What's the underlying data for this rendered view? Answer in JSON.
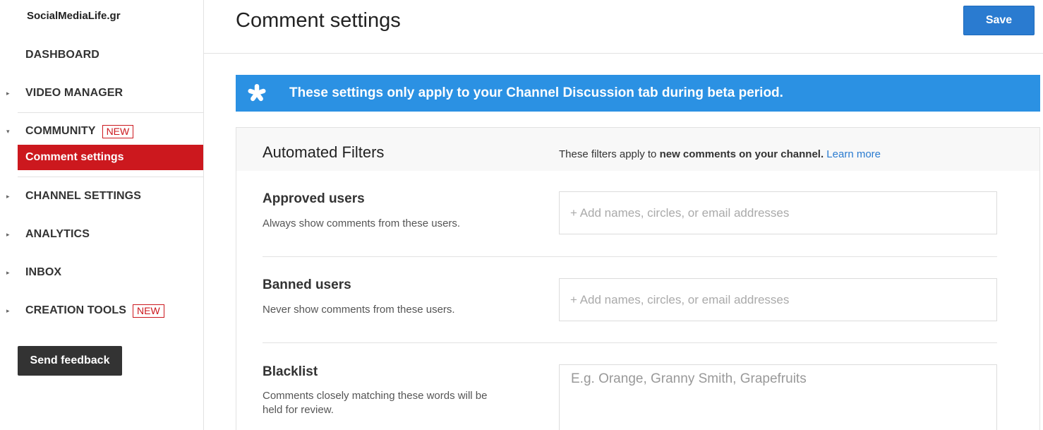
{
  "sidebar": {
    "channel_name": "SocialMediaLife.gr",
    "items": [
      {
        "label": "DASHBOARD",
        "arrow": ""
      },
      {
        "label": "VIDEO MANAGER",
        "arrow": "▸"
      },
      {
        "label": "COMMUNITY",
        "arrow": "▾",
        "badge": "NEW"
      },
      {
        "label": "CHANNEL SETTINGS",
        "arrow": "▸"
      },
      {
        "label": "ANALYTICS",
        "arrow": "▸"
      },
      {
        "label": "INBOX",
        "arrow": "▸"
      },
      {
        "label": "CREATION TOOLS",
        "arrow": "▸",
        "badge": "NEW"
      }
    ],
    "active_sub_item": "Comment settings",
    "feedback_label": "Send feedback"
  },
  "header": {
    "title": "Comment settings",
    "save_label": "Save"
  },
  "banner": {
    "icon": "asterisk-icon",
    "text": "These settings only apply to your Channel Discussion tab during beta period."
  },
  "filters": {
    "title": "Automated Filters",
    "desc_prefix": "These filters apply to ",
    "desc_bold": "new comments on your channel.",
    "learn_more": "Learn more",
    "rows": [
      {
        "title": "Approved users",
        "desc": "Always show comments from these users.",
        "placeholder": "+ Add names, circles, or email addresses"
      },
      {
        "title": "Banned users",
        "desc": "Never show comments from these users.",
        "placeholder": "+ Add names, circles, or email addresses"
      },
      {
        "title": "Blacklist",
        "desc": "Comments closely matching these words will be held for review.",
        "placeholder": "E.g. Orange, Granny Smith, Grapefruits"
      }
    ]
  },
  "colors": {
    "accent_red": "#cc181e",
    "accent_blue": "#2b91e3",
    "save_blue": "#2a7bd0",
    "feedback_dark": "#333333"
  }
}
